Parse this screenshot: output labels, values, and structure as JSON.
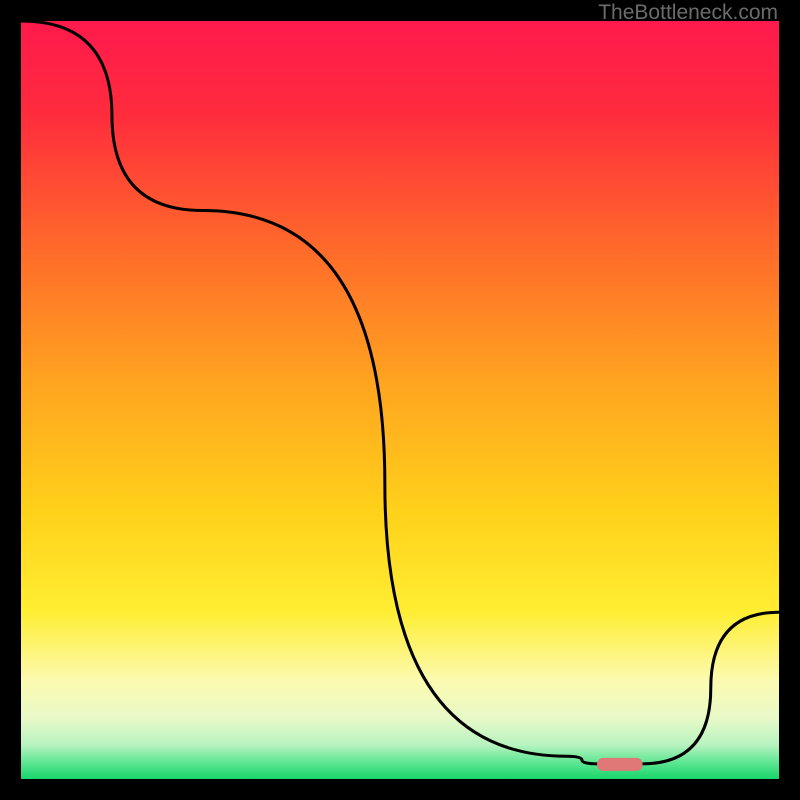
{
  "watermark": "TheBottleneck.com",
  "chart_data": {
    "type": "line",
    "title": "",
    "xlabel": "",
    "ylabel": "",
    "xlim": [
      0,
      100
    ],
    "ylim": [
      0,
      100
    ],
    "grid": false,
    "series": [
      {
        "name": "curve",
        "x": [
          0,
          24,
          72,
          76,
          82,
          100
        ],
        "values": [
          100,
          75,
          3,
          2,
          2,
          22
        ]
      }
    ],
    "marker": {
      "x_start": 76,
      "x_end": 82,
      "y": 2
    },
    "gradient_stops": [
      {
        "pos": 0.0,
        "color": "#ff1a4d"
      },
      {
        "pos": 0.12,
        "color": "#ff2b3d"
      },
      {
        "pos": 0.3,
        "color": "#ff6a2a"
      },
      {
        "pos": 0.48,
        "color": "#ffa51f"
      },
      {
        "pos": 0.65,
        "color": "#ffd21a"
      },
      {
        "pos": 0.78,
        "color": "#ffee33"
      },
      {
        "pos": 0.87,
        "color": "#fcfab0"
      },
      {
        "pos": 0.92,
        "color": "#e8f9c8"
      },
      {
        "pos": 0.955,
        "color": "#b7f3c0"
      },
      {
        "pos": 0.978,
        "color": "#5fe693"
      },
      {
        "pos": 1.0,
        "color": "#17d66a"
      }
    ],
    "marker_color": "#e07878",
    "line_color": "#000000"
  }
}
